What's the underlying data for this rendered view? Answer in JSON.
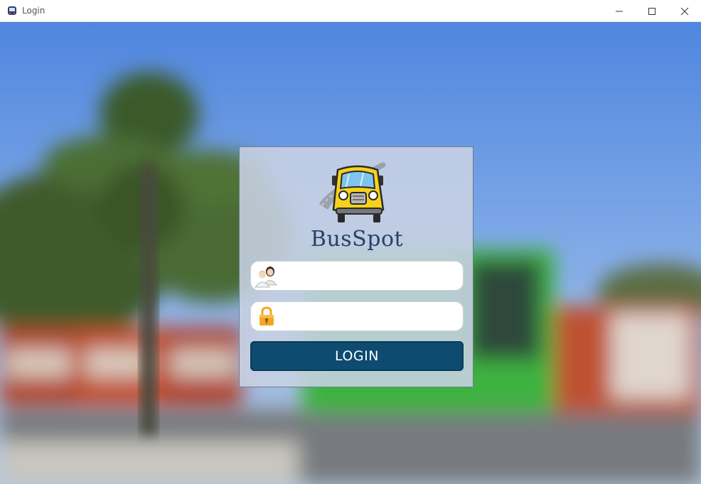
{
  "window": {
    "title": "Login",
    "controls": [
      "minimize",
      "maximize",
      "close"
    ]
  },
  "login": {
    "brand": "BusSpot",
    "username": {
      "value": "",
      "placeholder": "",
      "icon": "users-icon"
    },
    "password": {
      "value": "",
      "placeholder": "",
      "icon": "padlock-icon"
    },
    "submit_label": "LOGIN"
  },
  "colors": {
    "panel": "#c8d2e4",
    "button": "#0e4b70",
    "brand_text": "#2a3f66",
    "padlock": "#f5a623",
    "bus_yellow": "#f6d21d"
  }
}
